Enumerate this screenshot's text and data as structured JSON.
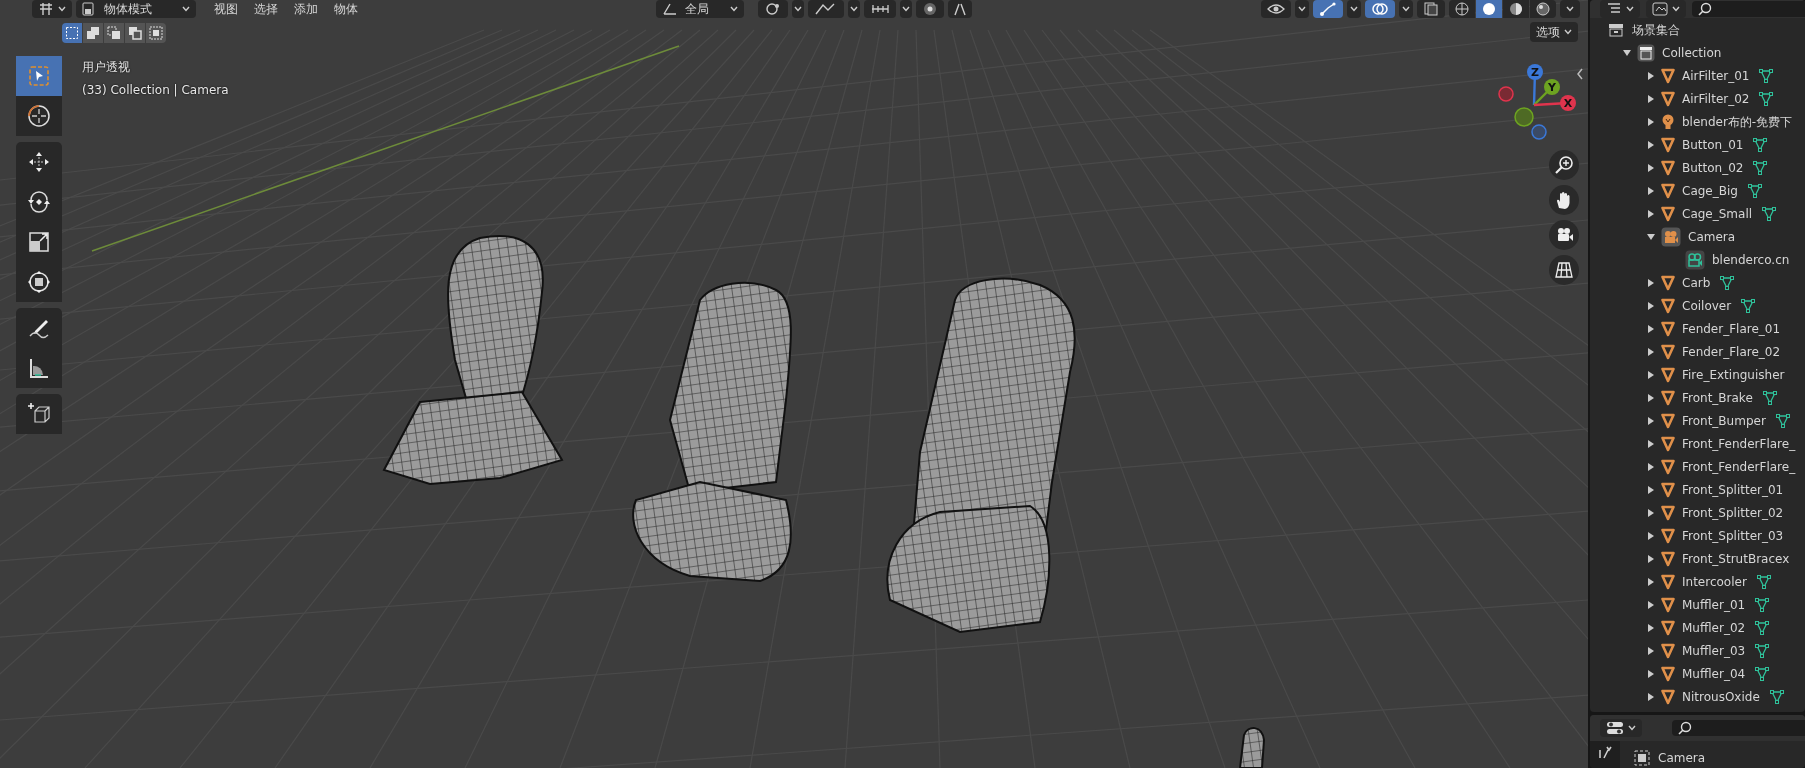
{
  "header": {
    "mode": "物体模式",
    "menus": [
      "视图",
      "选择",
      "添加",
      "物体"
    ],
    "orientation": "全局",
    "snapping": {
      "on": false
    },
    "proportional": {
      "on": false
    },
    "toggles": [
      {
        "kind": "visibility",
        "on": false
      },
      {
        "kind": "gizmo",
        "on": true
      },
      {
        "kind": "overlay",
        "on": true
      },
      {
        "kind": "xray",
        "on": false
      }
    ],
    "shading": [
      {
        "kind": "wireframe",
        "selected": false
      },
      {
        "kind": "solid",
        "selected": true
      },
      {
        "kind": "material",
        "selected": false
      },
      {
        "kind": "rendered",
        "selected": false
      }
    ]
  },
  "selection_modes": [
    {
      "kind": "set",
      "selected": true
    },
    {
      "kind": "extend",
      "selected": false
    },
    {
      "kind": "subtract",
      "selected": false
    },
    {
      "kind": "difference",
      "selected": false
    },
    {
      "kind": "intersect",
      "selected": false
    }
  ],
  "viewport": {
    "view_name": "用户透视",
    "view_info": "(33) Collection | Camera",
    "options": "选项",
    "axes": [
      {
        "label": "Z"
      },
      {
        "label": "Y"
      },
      {
        "label": "X"
      }
    ]
  },
  "tools": [
    {
      "kind": "select",
      "selected": true,
      "gap_before": false
    },
    {
      "kind": "cursor",
      "selected": false,
      "gap_before": false
    },
    {
      "kind": "move",
      "selected": false,
      "gap_before": true
    },
    {
      "kind": "rotate",
      "selected": false,
      "gap_before": false
    },
    {
      "kind": "scale",
      "selected": false,
      "gap_before": false
    },
    {
      "kind": "transform",
      "selected": false,
      "gap_before": false
    },
    {
      "kind": "annotate",
      "selected": false,
      "gap_before": true
    },
    {
      "kind": "measure",
      "selected": false,
      "gap_before": false
    },
    {
      "kind": "add",
      "selected": false,
      "gap_before": true
    }
  ],
  "outliner": {
    "root": "场景集合",
    "items": [
      {
        "label": "Collection",
        "kind": "collection",
        "expanded": true,
        "children": [
          {
            "label": "AirFilter_01",
            "kind": "mesh",
            "expanded": false,
            "data_icon": true
          },
          {
            "label": "AirFilter_02",
            "kind": "mesh",
            "expanded": false,
            "data_icon": true
          },
          {
            "label": "blender布的-免费下",
            "kind": "light",
            "expanded": false,
            "data_icon": false
          },
          {
            "label": "Button_01",
            "kind": "mesh",
            "expanded": false,
            "data_icon": true
          },
          {
            "label": "Button_02",
            "kind": "mesh",
            "expanded": false,
            "data_icon": true
          },
          {
            "label": "Cage_Big",
            "kind": "mesh",
            "expanded": false,
            "data_icon": true
          },
          {
            "label": "Cage_Small",
            "kind": "mesh",
            "expanded": false,
            "data_icon": true
          },
          {
            "label": "Camera",
            "kind": "camera",
            "expanded": true,
            "data_icon": false,
            "children": [
              {
                "label": "blenderco.cn",
                "kind": "camera-data",
                "data_icon": false
              }
            ]
          },
          {
            "label": "Carb",
            "kind": "mesh",
            "expanded": false,
            "data_icon": true
          },
          {
            "label": "Coilover",
            "kind": "mesh",
            "expanded": false,
            "data_icon": true
          },
          {
            "label": "Fender_Flare_01",
            "kind": "mesh",
            "expanded": false,
            "data_icon": false
          },
          {
            "label": "Fender_Flare_02",
            "kind": "mesh",
            "expanded": false,
            "data_icon": false
          },
          {
            "label": "Fire_Extinguisher",
            "kind": "mesh",
            "expanded": false,
            "data_icon": false
          },
          {
            "label": "Front_Brake",
            "kind": "mesh",
            "expanded": false,
            "data_icon": true
          },
          {
            "label": "Front_Bumper",
            "kind": "mesh",
            "expanded": false,
            "data_icon": true
          },
          {
            "label": "Front_FenderFlare_",
            "kind": "mesh",
            "expanded": false,
            "data_icon": false
          },
          {
            "label": "Front_FenderFlare_",
            "kind": "mesh",
            "expanded": false,
            "data_icon": false
          },
          {
            "label": "Front_Splitter_01",
            "kind": "mesh",
            "expanded": false,
            "data_icon": false
          },
          {
            "label": "Front_Splitter_02",
            "kind": "mesh",
            "expanded": false,
            "data_icon": false
          },
          {
            "label": "Front_Splitter_03",
            "kind": "mesh",
            "expanded": false,
            "data_icon": false
          },
          {
            "label": "Front_StrutBracex",
            "kind": "mesh",
            "expanded": false,
            "data_icon": false
          },
          {
            "label": "Intercooler",
            "kind": "mesh",
            "expanded": false,
            "data_icon": true
          },
          {
            "label": "Muffler_01",
            "kind": "mesh",
            "expanded": false,
            "data_icon": true
          },
          {
            "label": "Muffler_02",
            "kind": "mesh",
            "expanded": false,
            "data_icon": true
          },
          {
            "label": "Muffler_03",
            "kind": "mesh",
            "expanded": false,
            "data_icon": true
          },
          {
            "label": "Muffler_04",
            "kind": "mesh",
            "expanded": false,
            "data_icon": true
          },
          {
            "label": "NitrousOxide",
            "kind": "mesh",
            "expanded": false,
            "data_icon": true
          }
        ]
      }
    ]
  },
  "properties": {
    "object": "Camera"
  }
}
